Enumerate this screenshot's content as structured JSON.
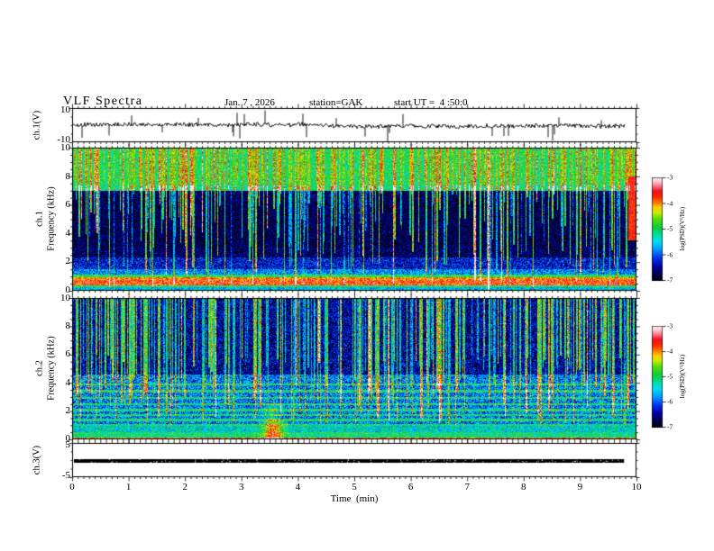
{
  "header": {
    "title": "VLF Spectra",
    "date": "Jan. 7 , 2026",
    "station": "station=GAK",
    "start_ut": "start UT =  4 :50:0"
  },
  "xaxis": {
    "label": "Time  (min)",
    "range": [
      0,
      10
    ],
    "major_ticks": [
      0,
      1,
      2,
      3,
      4,
      5,
      6,
      7,
      8,
      9,
      10
    ],
    "minor_step": 0.1
  },
  "panels": {
    "ch1_wave": {
      "ylabel": "ch.1(V)",
      "ylim": [
        -10,
        10
      ],
      "ytick_labels": [
        "10",
        "-10"
      ],
      "ytick_values": [
        10,
        -10
      ]
    },
    "ch1_spec": {
      "label_channel": "ch.1",
      "label_axis": "Frequency (kHz)",
      "ylim": [
        0,
        10
      ],
      "ytick_values": [
        10,
        8,
        6,
        4,
        2,
        0
      ]
    },
    "ch2_spec": {
      "label_channel": "ch.2",
      "label_axis": "Frequency (kHz)",
      "ylim": [
        0,
        10
      ],
      "ytick_values": [
        10,
        8,
        6,
        4,
        2,
        0
      ]
    },
    "ch3_wave": {
      "ylabel": "ch.3(V)",
      "ylim": [
        -5,
        5
      ],
      "ytick_labels": [
        "5",
        "-5"
      ],
      "ytick_values": [
        5,
        -5
      ]
    }
  },
  "colorbar": {
    "label": "log(PSD)(V²/Hz)",
    "tick_values": [
      -3,
      -4,
      -5,
      -6,
      -7
    ],
    "range": [
      -7,
      -3
    ]
  },
  "colormap": [
    [
      0.0,
      "#000010"
    ],
    [
      0.06,
      "#000044"
    ],
    [
      0.14,
      "#0000aa"
    ],
    [
      0.22,
      "#0033ee"
    ],
    [
      0.3,
      "#0099ff"
    ],
    [
      0.38,
      "#00ddee"
    ],
    [
      0.45,
      "#00dd99"
    ],
    [
      0.52,
      "#11cc33"
    ],
    [
      0.6,
      "#55dd11"
    ],
    [
      0.66,
      "#ccee00"
    ],
    [
      0.71,
      "#ffcc00"
    ],
    [
      0.76,
      "#ff7700"
    ],
    [
      0.81,
      "#ff2a00"
    ],
    [
      0.87,
      "#ee1122"
    ],
    [
      0.92,
      "#ff7788"
    ],
    [
      0.96,
      "#ffc4cc"
    ],
    [
      1.0,
      "#ffeef2"
    ]
  ],
  "chart_data": [
    {
      "id": "ch1_waveform",
      "type": "line",
      "xlabel": "Time (min)",
      "xlim": [
        0,
        10
      ],
      "ylabel": "ch.1(V)",
      "ylim": [
        -10,
        10
      ],
      "summary": {
        "mean_V": 0,
        "noise_band_V": 1.2,
        "negative_spikes_to_V": -9,
        "positive_spikes_to_V": 8,
        "trace_end_min": 9.8
      },
      "model": {
        "seed": 5,
        "noise_V": 1.2,
        "wander_V": 0.8,
        "spikes": {
          "count": 26,
          "down_fraction": 0.62,
          "mag_V": [
            3.5,
            9
          ]
        }
      }
    },
    {
      "id": "ch1_spectrogram",
      "type": "heatmap",
      "xlim": [
        0,
        10
      ],
      "ylim_khz": [
        0,
        10
      ],
      "zlabel": "log(PSD)(V²/Hz)",
      "zlim": [
        -7,
        -3
      ],
      "bands": [
        {
          "f": [
            0,
            0.2
          ],
          "psd": -5.6
        },
        {
          "f": [
            0.2,
            0.35
          ],
          "psd": -5.0
        },
        {
          "f": [
            0.35,
            0.7
          ],
          "psd": -3.7
        },
        {
          "f": [
            0.7,
            0.9
          ],
          "psd": -4.0
        },
        {
          "f": [
            0.9,
            1.1
          ],
          "psd": -4.9
        },
        {
          "f": [
            1.1,
            1.5
          ],
          "psd": -5.8
        },
        {
          "f": [
            1.5,
            2.3
          ],
          "psd": -6.3
        },
        {
          "f": [
            2.3,
            7.0
          ],
          "psd": -6.7
        },
        {
          "f": [
            7.0,
            7.35
          ],
          "psd": -5.1
        },
        {
          "f": [
            7.35,
            10.01
          ],
          "psd": -5.0
        }
      ],
      "features": [
        "dense vertical sferic streaks (green/cyan, a few red-hot)",
        "narrow cyan line near 7 kHz",
        "strong red/orange band 0.35-0.9 kHz",
        "dark navy background 2.3-7 kHz",
        "red patch at right edge 4-8 kHz near 9.9 min"
      ],
      "model": {
        "seed": 11,
        "noise": 0.13,
        "streaks": {
          "count": 330,
          "strength": [
            0.15,
            0.6
          ],
          "hot_fraction": 0.07,
          "hot_strength": [
            0.65,
            0.9
          ],
          "end_khz": [
            0,
            8
          ],
          "top_damp_above_khz": 7.35,
          "top_damp": 0.45
        },
        "flecks": {
          "above_khz": 7.35,
          "prob": 0.012,
          "v": 0.9
        },
        "edge_blob": {
          "x_min": 9.85,
          "f_khz": [
            3.5,
            8
          ],
          "v": 0.78
        }
      }
    },
    {
      "id": "ch2_spectrogram",
      "type": "heatmap",
      "xlim": [
        0,
        10
      ],
      "ylim_khz": [
        0,
        10
      ],
      "zlabel": "log(PSD)(V²/Hz)",
      "zlim": [
        -7,
        -3
      ],
      "bands": [
        {
          "f": [
            0,
            0.12
          ],
          "psd": -3.9
        },
        {
          "f": [
            0.12,
            0.5
          ],
          "psd": -5.1
        },
        {
          "f": [
            0.5,
            0.9
          ],
          "psd": -5.4
        },
        {
          "f": [
            0.9,
            4.6
          ],
          "psd": -5.9
        },
        {
          "f": [
            4.6,
            10.01
          ],
          "psd": -6.5
        }
      ],
      "features": [
        "vertical sferic streaks hanging from top down to ~1-6 kHz",
        "horizontal cyan interference lines between 1 and 4 kHz",
        "bright cyan speckled background below 4.6 kHz",
        "green patch near 3.5 min below ~1.3 kHz",
        "thin red/yellow line at 0 kHz"
      ],
      "model": {
        "seed": 23,
        "noise": 0.15,
        "streaks": {
          "count": 300,
          "strength": [
            0.15,
            0.55
          ],
          "hot_fraction": 0.06,
          "hot_strength": [
            0.6,
            0.8
          ],
          "end_khz": [
            1,
            6
          ]
        },
        "hlines_khz": [
          1.0,
          1.35,
          1.7,
          2.05,
          2.45,
          2.9,
          3.4,
          3.9
        ],
        "hline_boost": 0.2,
        "speckle": {
          "f_khz": [
            0.9,
            4.6
          ],
          "prob": 0.06,
          "v": 0.2
        },
        "blob": {
          "x_min": 3.55,
          "sigma_min": 0.18,
          "f_khz": 1.3,
          "v_boost": 0.35
        }
      }
    },
    {
      "id": "ch3_waveform",
      "type": "line",
      "xlabel": "Time (min)",
      "xlim": [
        0,
        10
      ],
      "ylabel": "ch.3(V)",
      "ylim": [
        -5,
        5
      ],
      "summary": {
        "value_V": 0,
        "trace_end_min": 9.78,
        "appearance": "flat thick black trace"
      },
      "model": {
        "seed": 41,
        "thickness_px": 4,
        "end_min": 9.78
      }
    }
  ]
}
